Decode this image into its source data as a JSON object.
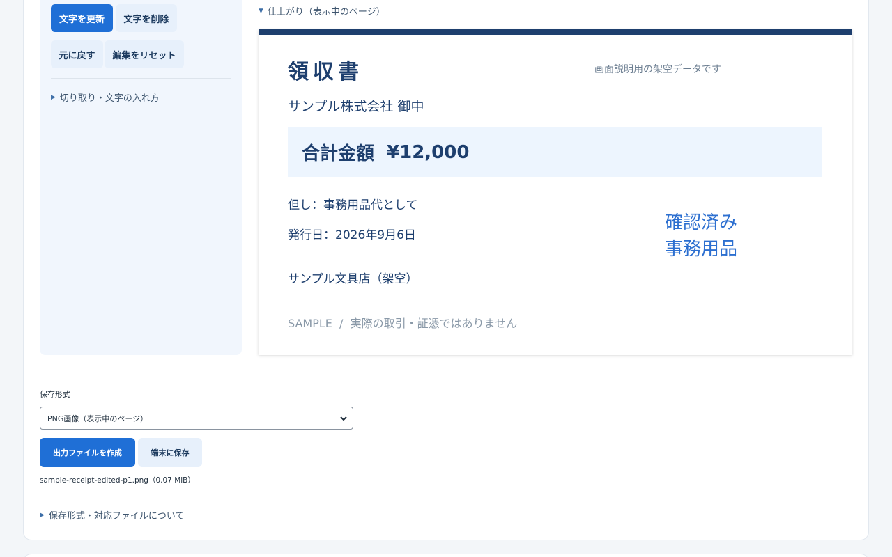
{
  "sidebar": {
    "update_text_label": "文字を更新",
    "delete_text_label": "文字を削除",
    "undo_label": "元に戻す",
    "reset_edit_label": "編集をリセット",
    "crop_guide_label": "切り取り・文字の入れ方"
  },
  "preview": {
    "disclosure_label": "仕上がり（表示中のページ）",
    "receipt": {
      "title": "領収書",
      "note": "画面説明用の架空データです",
      "addressee": "サンプル株式会社 御中",
      "total_label": "合計金額",
      "total_amount": "¥12,000",
      "purpose": "但し：事務用品代として",
      "issue_date": "発行日：2026年9月6日",
      "issuer": "サンプル文具店（架空）",
      "stamp_line1": "確認済み",
      "stamp_line2": "事務用品",
      "footer": "SAMPLE  /  実際の取引・証憑ではありません"
    }
  },
  "export": {
    "format_label": "保存形式",
    "format_selected": "PNG画像（表示中のページ）",
    "create_button_label": "出力ファイルを作成",
    "save_button_label": "端末に保存",
    "output_file": "sample-receipt-edited-p1.png（0.07 MiB）",
    "formats_info_label": "保存形式・対応ファイルについて"
  },
  "colors": {
    "primary": "#1f6fd6",
    "navy": "#1e3f6e",
    "stamp_blue": "#2c6fd0",
    "sidebar_bg": "#f1f6fd"
  }
}
